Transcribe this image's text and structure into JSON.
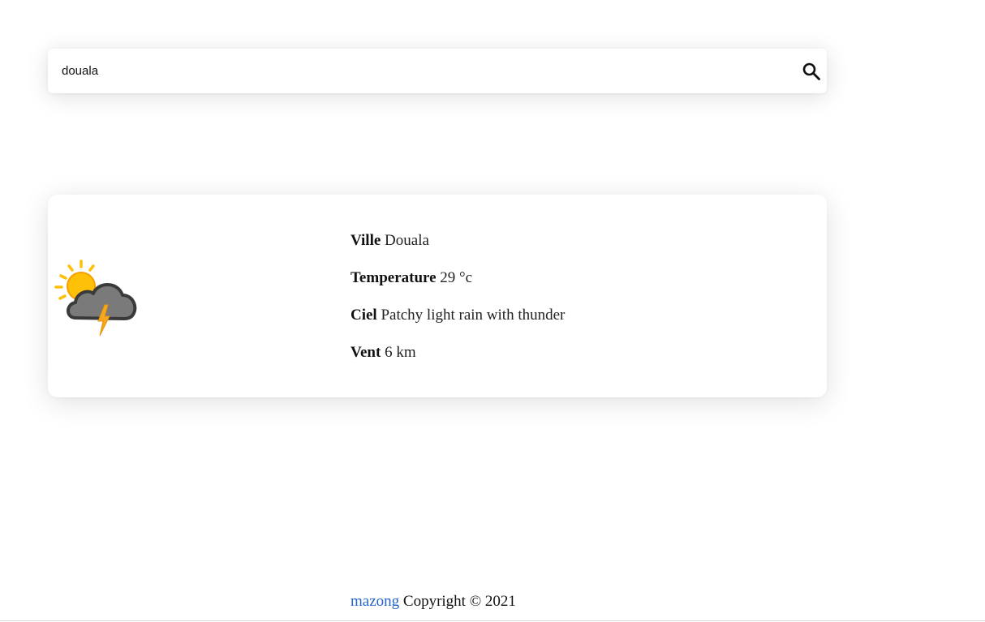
{
  "search": {
    "value": "douala",
    "placeholder": "",
    "button_icon": "search-icon"
  },
  "weather": {
    "icon": "cloud-sun-thunder-icon",
    "rows": [
      {
        "label": "Ville",
        "value": "Douala"
      },
      {
        "label": "Temperature",
        "value": "29 °c"
      },
      {
        "label": "Ciel",
        "value": "Patchy light rain with thunder"
      },
      {
        "label": "Vent",
        "value": "6 km"
      }
    ]
  },
  "footer": {
    "link_text": "mazong",
    "text": "Copyright © 2021"
  },
  "colors": {
    "link": "#2563c8",
    "sun": "#FFC107",
    "cloud": "#7a7a7a",
    "lightning": "#F5A623"
  }
}
